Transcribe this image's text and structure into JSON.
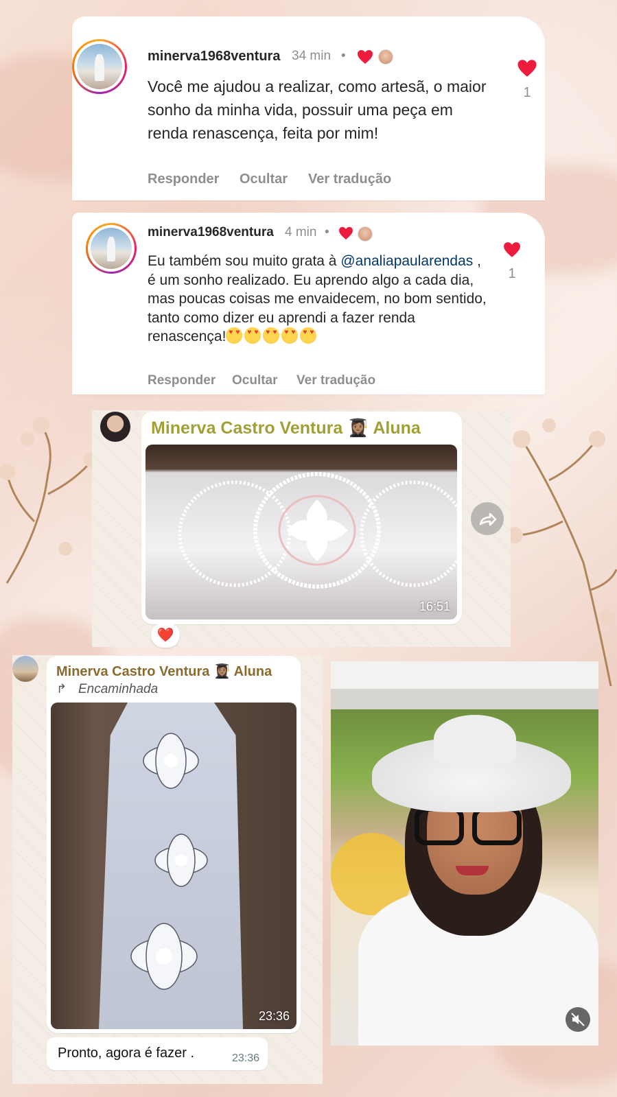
{
  "comments": [
    {
      "username": "minerva1968ventura",
      "time_ago": "34 min",
      "separator": "•",
      "text": "Você me ajudou a realizar, como artesã, o maior sonho da minha vida, possuir uma peça em renda renascença, feita por mim!",
      "like_count": "1",
      "actions": [
        "Responder",
        "Ocultar",
        "Ver tradução"
      ]
    },
    {
      "username": "minerva1968ventura",
      "time_ago": "4 min",
      "separator": "•",
      "text_before_mention": "Eu também sou muito grata à",
      "mention": "@analiapaularendas",
      "text_after_mention": ", é um sonho realizado. Eu aprendo algo a cada dia, mas poucas coisas me envaidecem, no bom sentido,  tanto como dizer eu aprendi a fazer renda renascença!",
      "emoji_count": 5,
      "like_count": "1",
      "actions": [
        "Responder",
        "Ocultar",
        "Ver tradução"
      ]
    }
  ],
  "whatsapp_messages": [
    {
      "sender": "Minerva Castro Ventura 👩🏽‍🎓 Aluna",
      "image_alt": "lace cloth",
      "timestamp": "16:51",
      "reaction": "❤️"
    },
    {
      "sender": "Minerva Castro Ventura 👩🏽‍🎓 Aluna",
      "forwarded_label": "Encaminhada",
      "image_alt": "lace dress",
      "timestamp": "23:36",
      "text": "Pronto, agora é fazer .",
      "text_timestamp": "23:36"
    }
  ],
  "photo": {
    "description": "selfie with lace hat",
    "mute_icon": "mute-icon"
  },
  "colors": {
    "heart": "#ed1c3c",
    "wa_sender": "#a1a036",
    "mention": "#00376b"
  }
}
